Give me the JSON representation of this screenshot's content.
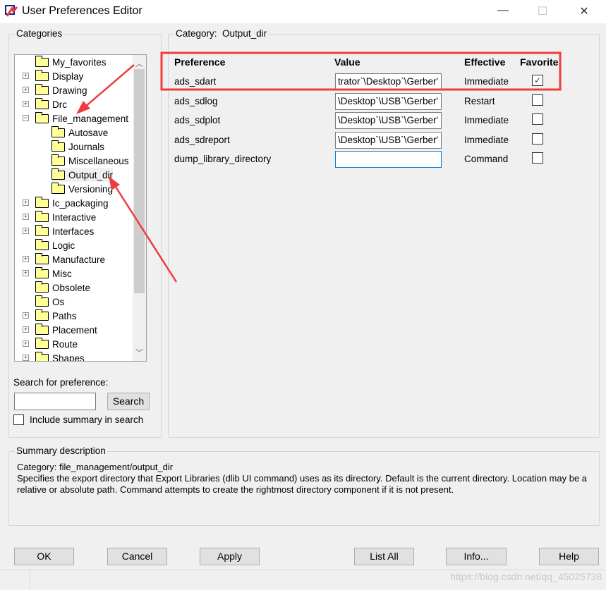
{
  "window": {
    "title": "User Preferences Editor",
    "minimize": "—",
    "maximize": "☐",
    "close": "✕"
  },
  "categories": {
    "label": "Categories",
    "items": [
      {
        "label": "My_favorites",
        "level": 0,
        "expander": ""
      },
      {
        "label": "Display",
        "level": 0,
        "expander": "+"
      },
      {
        "label": "Drawing",
        "level": 0,
        "expander": "+"
      },
      {
        "label": "Drc",
        "level": 0,
        "expander": "+"
      },
      {
        "label": "File_management",
        "level": 0,
        "expander": "−"
      },
      {
        "label": "Autosave",
        "level": 1,
        "expander": ""
      },
      {
        "label": "Journals",
        "level": 1,
        "expander": ""
      },
      {
        "label": "Miscellaneous",
        "level": 1,
        "expander": ""
      },
      {
        "label": "Output_dir",
        "level": 1,
        "expander": "",
        "selected": true
      },
      {
        "label": "Versioning",
        "level": 1,
        "expander": ""
      },
      {
        "label": "Ic_packaging",
        "level": 0,
        "expander": "+"
      },
      {
        "label": "Interactive",
        "level": 0,
        "expander": "+"
      },
      {
        "label": "Interfaces",
        "level": 0,
        "expander": "+"
      },
      {
        "label": "Logic",
        "level": 0,
        "expander": ""
      },
      {
        "label": "Manufacture",
        "level": 0,
        "expander": "+"
      },
      {
        "label": "Misc",
        "level": 0,
        "expander": "+"
      },
      {
        "label": "Obsolete",
        "level": 0,
        "expander": ""
      },
      {
        "label": "Os",
        "level": 0,
        "expander": ""
      },
      {
        "label": "Paths",
        "level": 0,
        "expander": "+"
      },
      {
        "label": "Placement",
        "level": 0,
        "expander": "+"
      },
      {
        "label": "Route",
        "level": 0,
        "expander": "+"
      },
      {
        "label": "Shapes",
        "level": 0,
        "expander": "+"
      }
    ]
  },
  "search": {
    "label": "Search for preference:",
    "value": "",
    "button": "Search",
    "include_summary": "Include summary in search",
    "include_checked": false
  },
  "category_panel": {
    "label": "Category:",
    "name": "Output_dir",
    "headers": {
      "preference": "Preference",
      "value": "Value",
      "effective": "Effective",
      "favorite": "Favorite"
    },
    "rows": [
      {
        "preference": "ads_sdart",
        "value": "trator`\\Desktop`\\Gerber'",
        "effective": "Immediate",
        "favorite": true
      },
      {
        "preference": "ads_sdlog",
        "value": "\\Desktop`\\USB`\\Gerber'",
        "effective": "Restart",
        "favorite": false
      },
      {
        "preference": "ads_sdplot",
        "value": "\\Desktop`\\USB`\\Gerber'",
        "effective": "Immediate",
        "favorite": false
      },
      {
        "preference": "ads_sdreport",
        "value": "\\Desktop`\\USB`\\Gerber'",
        "effective": "Immediate",
        "favorite": false
      },
      {
        "preference": "dump_library_directory",
        "value": "",
        "effective": "Command",
        "favorite": false
      }
    ]
  },
  "summary": {
    "label": "Summary description",
    "category": "Category: file_management/output_dir",
    "text": "Specifies the export directory that Export Libraries (dlib UI command) uses as its directory. Default is the current directory. Location may be a relative or absolute path. Command attempts to create the rightmost directory component if it is not present."
  },
  "buttons": {
    "ok": "OK",
    "cancel": "Cancel",
    "apply": "Apply",
    "list_all": "List All",
    "info": "Info...",
    "help": "Help"
  },
  "watermark": "https://blog.csdn.net/qq_45025738",
  "colors": {
    "annotation": "#f03c3c",
    "background": "#f0f0f0",
    "folder": "#ffff99"
  }
}
